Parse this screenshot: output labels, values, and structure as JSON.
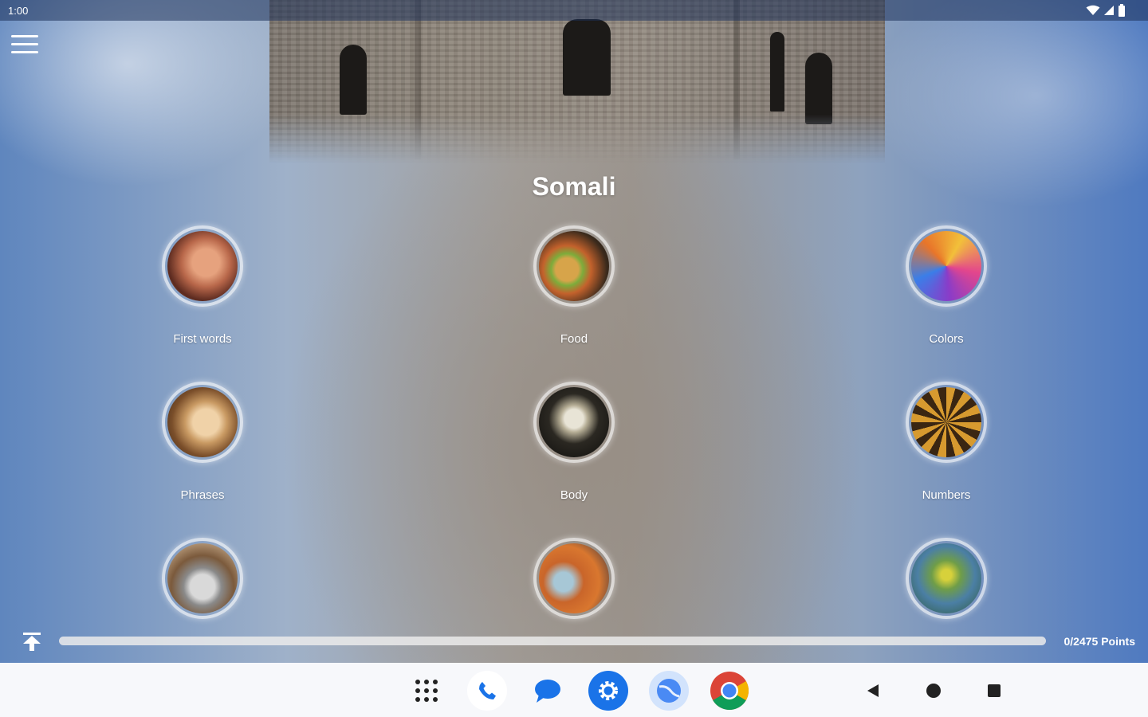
{
  "status_bar": {
    "time": "1:00"
  },
  "app": {
    "title": "Somali",
    "categories": [
      {
        "label": "First words"
      },
      {
        "label": "Food"
      },
      {
        "label": "Colors"
      },
      {
        "label": "Phrases"
      },
      {
        "label": "Body"
      },
      {
        "label": "Numbers"
      },
      {
        "label": ""
      },
      {
        "label": ""
      },
      {
        "label": ""
      }
    ],
    "progress": {
      "points_text": "0/2475 Points",
      "fraction": 0
    }
  },
  "dock": {
    "icons": [
      "app-grid-icon",
      "phone-icon",
      "messages-icon",
      "settings-icon",
      "maps-icon",
      "chrome-icon"
    ]
  },
  "navigation": {
    "keys": [
      "back-icon",
      "home-icon",
      "recents-icon"
    ]
  },
  "colors": {
    "accent": "#1a73e8",
    "navbar_bg": "#f7f8fb",
    "text_on_image": "#ffffff"
  }
}
